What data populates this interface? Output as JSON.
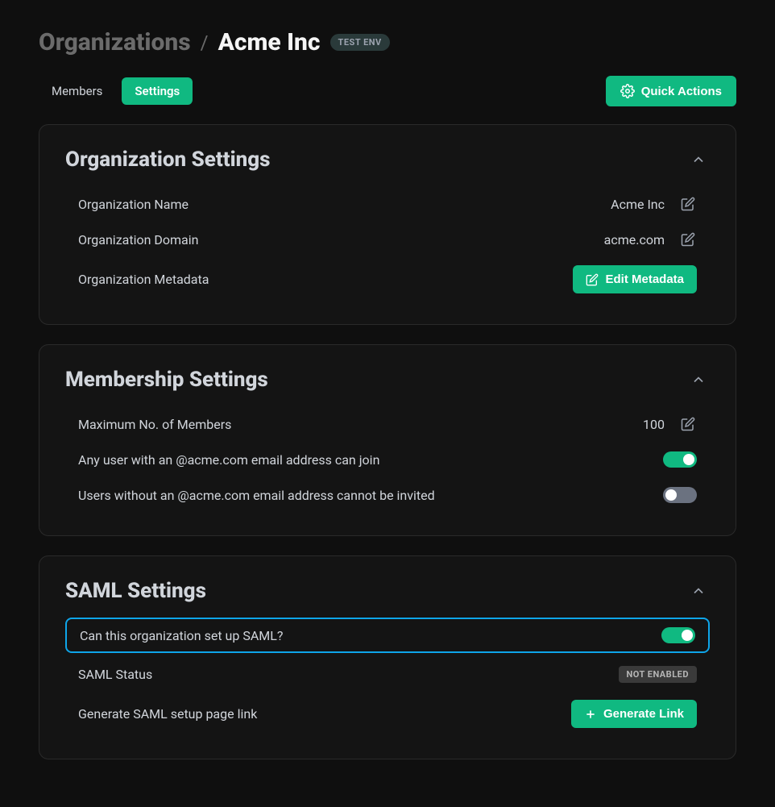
{
  "breadcrumb": {
    "root": "Organizations",
    "separator": "/",
    "current": "Acme Inc",
    "env_badge": "TEST ENV"
  },
  "tabs": {
    "members": "Members",
    "settings": "Settings"
  },
  "quick_actions_label": "Quick Actions",
  "org_settings": {
    "title": "Organization Settings",
    "rows": {
      "name_label": "Organization Name",
      "name_value": "Acme Inc",
      "domain_label": "Organization Domain",
      "domain_value": "acme.com",
      "metadata_label": "Organization Metadata",
      "edit_metadata_btn": "Edit Metadata"
    }
  },
  "membership_settings": {
    "title": "Membership Settings",
    "max_members_label": "Maximum No. of Members",
    "max_members_value": "100",
    "any_user_join_label": "Any user with an @acme.com email address can join",
    "any_user_join_enabled": true,
    "users_without_label": "Users without an @acme.com email address cannot be invited",
    "users_without_enabled": false
  },
  "saml_settings": {
    "title": "SAML Settings",
    "can_setup_label": "Can this organization set up SAML?",
    "can_setup_enabled": true,
    "status_label": "SAML Status",
    "status_value": "NOT ENABLED",
    "generate_link_label": "Generate SAML setup page link",
    "generate_link_btn": "Generate Link"
  }
}
